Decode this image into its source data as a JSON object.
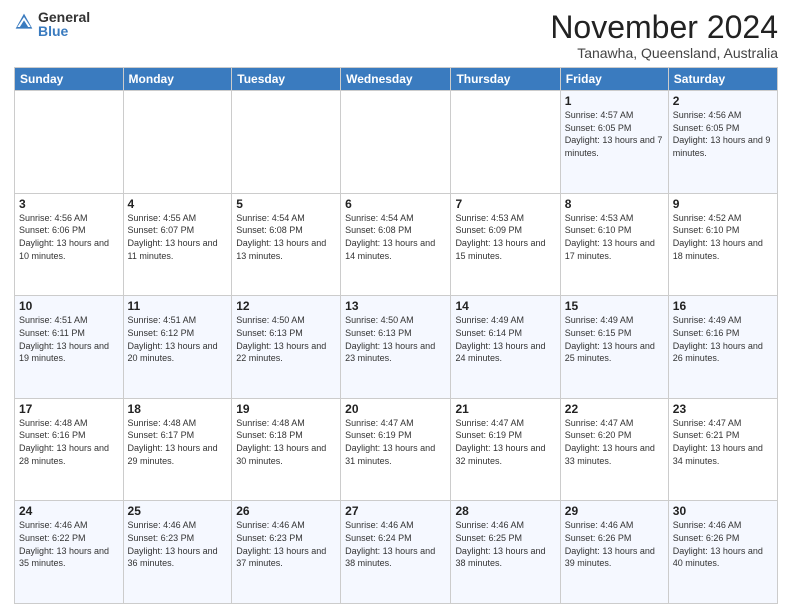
{
  "logo": {
    "general": "General",
    "blue": "Blue"
  },
  "header": {
    "month": "November 2024",
    "location": "Tanawha, Queensland, Australia"
  },
  "weekdays": [
    "Sunday",
    "Monday",
    "Tuesday",
    "Wednesday",
    "Thursday",
    "Friday",
    "Saturday"
  ],
  "weeks": [
    [
      {
        "day": "",
        "info": ""
      },
      {
        "day": "",
        "info": ""
      },
      {
        "day": "",
        "info": ""
      },
      {
        "day": "",
        "info": ""
      },
      {
        "day": "",
        "info": ""
      },
      {
        "day": "1",
        "info": "Sunrise: 4:57 AM\nSunset: 6:05 PM\nDaylight: 13 hours and 7 minutes."
      },
      {
        "day": "2",
        "info": "Sunrise: 4:56 AM\nSunset: 6:05 PM\nDaylight: 13 hours and 9 minutes."
      }
    ],
    [
      {
        "day": "3",
        "info": "Sunrise: 4:56 AM\nSunset: 6:06 PM\nDaylight: 13 hours and 10 minutes."
      },
      {
        "day": "4",
        "info": "Sunrise: 4:55 AM\nSunset: 6:07 PM\nDaylight: 13 hours and 11 minutes."
      },
      {
        "day": "5",
        "info": "Sunrise: 4:54 AM\nSunset: 6:08 PM\nDaylight: 13 hours and 13 minutes."
      },
      {
        "day": "6",
        "info": "Sunrise: 4:54 AM\nSunset: 6:08 PM\nDaylight: 13 hours and 14 minutes."
      },
      {
        "day": "7",
        "info": "Sunrise: 4:53 AM\nSunset: 6:09 PM\nDaylight: 13 hours and 15 minutes."
      },
      {
        "day": "8",
        "info": "Sunrise: 4:53 AM\nSunset: 6:10 PM\nDaylight: 13 hours and 17 minutes."
      },
      {
        "day": "9",
        "info": "Sunrise: 4:52 AM\nSunset: 6:10 PM\nDaylight: 13 hours and 18 minutes."
      }
    ],
    [
      {
        "day": "10",
        "info": "Sunrise: 4:51 AM\nSunset: 6:11 PM\nDaylight: 13 hours and 19 minutes."
      },
      {
        "day": "11",
        "info": "Sunrise: 4:51 AM\nSunset: 6:12 PM\nDaylight: 13 hours and 20 minutes."
      },
      {
        "day": "12",
        "info": "Sunrise: 4:50 AM\nSunset: 6:13 PM\nDaylight: 13 hours and 22 minutes."
      },
      {
        "day": "13",
        "info": "Sunrise: 4:50 AM\nSunset: 6:13 PM\nDaylight: 13 hours and 23 minutes."
      },
      {
        "day": "14",
        "info": "Sunrise: 4:49 AM\nSunset: 6:14 PM\nDaylight: 13 hours and 24 minutes."
      },
      {
        "day": "15",
        "info": "Sunrise: 4:49 AM\nSunset: 6:15 PM\nDaylight: 13 hours and 25 minutes."
      },
      {
        "day": "16",
        "info": "Sunrise: 4:49 AM\nSunset: 6:16 PM\nDaylight: 13 hours and 26 minutes."
      }
    ],
    [
      {
        "day": "17",
        "info": "Sunrise: 4:48 AM\nSunset: 6:16 PM\nDaylight: 13 hours and 28 minutes."
      },
      {
        "day": "18",
        "info": "Sunrise: 4:48 AM\nSunset: 6:17 PM\nDaylight: 13 hours and 29 minutes."
      },
      {
        "day": "19",
        "info": "Sunrise: 4:48 AM\nSunset: 6:18 PM\nDaylight: 13 hours and 30 minutes."
      },
      {
        "day": "20",
        "info": "Sunrise: 4:47 AM\nSunset: 6:19 PM\nDaylight: 13 hours and 31 minutes."
      },
      {
        "day": "21",
        "info": "Sunrise: 4:47 AM\nSunset: 6:19 PM\nDaylight: 13 hours and 32 minutes."
      },
      {
        "day": "22",
        "info": "Sunrise: 4:47 AM\nSunset: 6:20 PM\nDaylight: 13 hours and 33 minutes."
      },
      {
        "day": "23",
        "info": "Sunrise: 4:47 AM\nSunset: 6:21 PM\nDaylight: 13 hours and 34 minutes."
      }
    ],
    [
      {
        "day": "24",
        "info": "Sunrise: 4:46 AM\nSunset: 6:22 PM\nDaylight: 13 hours and 35 minutes."
      },
      {
        "day": "25",
        "info": "Sunrise: 4:46 AM\nSunset: 6:23 PM\nDaylight: 13 hours and 36 minutes."
      },
      {
        "day": "26",
        "info": "Sunrise: 4:46 AM\nSunset: 6:23 PM\nDaylight: 13 hours and 37 minutes."
      },
      {
        "day": "27",
        "info": "Sunrise: 4:46 AM\nSunset: 6:24 PM\nDaylight: 13 hours and 38 minutes."
      },
      {
        "day": "28",
        "info": "Sunrise: 4:46 AM\nSunset: 6:25 PM\nDaylight: 13 hours and 38 minutes."
      },
      {
        "day": "29",
        "info": "Sunrise: 4:46 AM\nSunset: 6:26 PM\nDaylight: 13 hours and 39 minutes."
      },
      {
        "day": "30",
        "info": "Sunrise: 4:46 AM\nSunset: 6:26 PM\nDaylight: 13 hours and 40 minutes."
      }
    ]
  ]
}
